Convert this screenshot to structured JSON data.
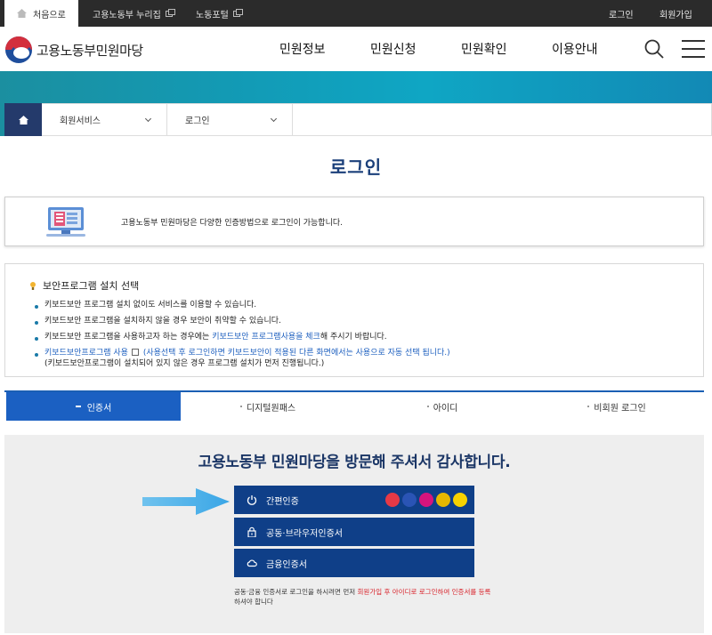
{
  "topbar": {
    "home_label": "처음으로",
    "links": [
      {
        "label": "고용노동부 누리집"
      },
      {
        "label": "노동포털"
      }
    ],
    "login_label": "로그인",
    "signup_label": "회원가입"
  },
  "header": {
    "logo_text": "고용노동부민원마당",
    "nav": [
      "민원정보",
      "민원신청",
      "민원확인",
      "이용안내"
    ]
  },
  "breadcrumb": {
    "items": [
      "회원서비스",
      "로그인"
    ]
  },
  "page": {
    "title": "로그인"
  },
  "info": {
    "text": "고용노동부 민원마당은 다양한 인증방법으로 로그인이 가능합니다."
  },
  "security": {
    "title": "보안프로그램 설치 선택",
    "line1": "키보드보안 프로그램 설치 없이도 서비스를 이용할 수 있습니다.",
    "line2": "키보드보안 프로그램을 설치하지 않을 경우 보안이 취약할 수 있습니다.",
    "line3_a": "키보드보안 프로그램을 사용하고자 하는 경우에는 ",
    "line3_b": "키보드보안 프로그램사용을 체크",
    "line3_c": "해 주시기 바랍니다.",
    "line4_label": "키보드보안프로그램 사용",
    "line4_note": "(사용선택 후 로그인하면 키보드보안이 적용된 다른 화면에서는 사용으로 자동 선택 됩니다.)",
    "line4_sub": "(키보드보안프로그램이 설치되어 있지 않은 경우 프로그램 설치가 먼저 진행됩니다.)"
  },
  "tabs": [
    "인증서",
    "디지털원패스",
    "아이디",
    "비회원 로그인"
  ],
  "login": {
    "welcome": "고용노동부 민원마당을 방문해 주셔서 감사합니다.",
    "simple_auth": "간편인증",
    "joint_cert": "공동·브라우저인증서",
    "finance_cert": "금융인증서",
    "providers": [
      {
        "name": "toss",
        "color": "#e63946"
      },
      {
        "name": "Pass",
        "color": "#2a54b5"
      },
      {
        "name": "PASS",
        "color": "#d6147d"
      },
      {
        "name": "KB",
        "color": "#e6b800"
      },
      {
        "name": "kakao",
        "color": "#f7d200"
      }
    ],
    "note_a": "공동·금융 인증서로 로그인을 하시려면 먼저 ",
    "note_b": "회원가입 후 아이디로 로그인하여 인증서를 등록",
    "note_c": " 하셔야 합니다"
  },
  "colors": {
    "primary": "#0f3f88",
    "tab_active": "#1b60c2",
    "banner": "#129bb6",
    "title": "#1a3f7a"
  }
}
